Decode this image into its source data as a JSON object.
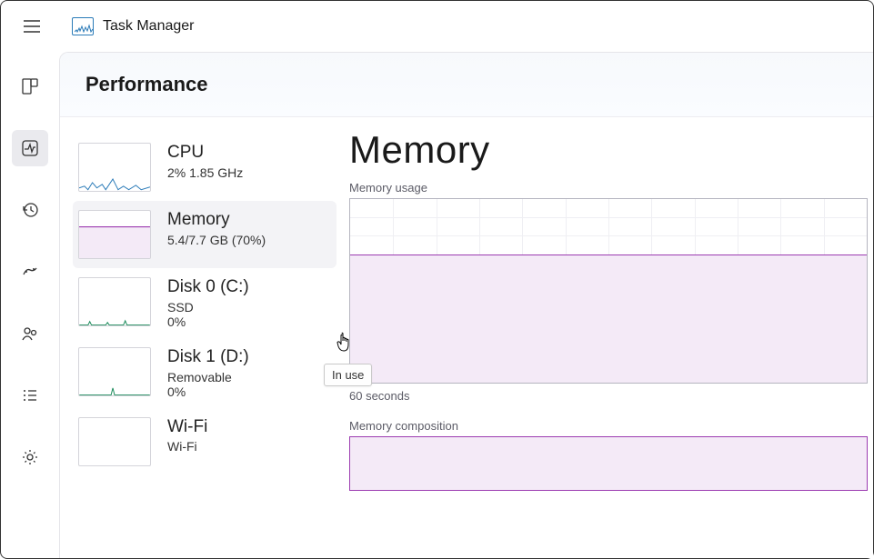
{
  "app": {
    "title": "Task Manager"
  },
  "page": {
    "heading": "Performance"
  },
  "perf_items": [
    {
      "name": "CPU",
      "sub1": "2%  1.85 GHz",
      "sub2": "",
      "thumb": "cpu"
    },
    {
      "name": "Memory",
      "sub1": "5.4/7.7 GB (70%)",
      "sub2": "",
      "thumb": "memory",
      "selected": true
    },
    {
      "name": "Disk 0 (C:)",
      "sub1": "SSD",
      "sub2": "0%",
      "thumb": "disk"
    },
    {
      "name": "Disk 1 (D:)",
      "sub1": "Removable",
      "sub2": "0%",
      "thumb": "empty"
    },
    {
      "name": "Wi-Fi",
      "sub1": "Wi-Fi",
      "sub2": "",
      "thumb": "wifi"
    }
  ],
  "tooltip": {
    "text": "In use"
  },
  "main": {
    "heading": "Memory",
    "usage_label": "Memory usage",
    "axis_label": "60 seconds",
    "composition_label": "Memory composition"
  },
  "chart_data": {
    "type": "area",
    "title": "Memory usage",
    "xlabel": "60 seconds",
    "ylabel": "",
    "ylim": [
      0,
      7.7
    ],
    "x_seconds": [
      60,
      55,
      50,
      45,
      40,
      35,
      30,
      25,
      20,
      15,
      10,
      5,
      0
    ],
    "series": [
      {
        "name": "In use (GB)",
        "values": [
          5.4,
          5.4,
          5.4,
          5.4,
          5.4,
          5.4,
          5.4,
          5.4,
          5.4,
          5.4,
          5.4,
          5.4,
          5.4
        ]
      }
    ],
    "fill_fraction": 0.7,
    "colors": {
      "line": "#9c3cb1",
      "fill": "#f4eaf7",
      "grid": "#efeff3"
    }
  }
}
